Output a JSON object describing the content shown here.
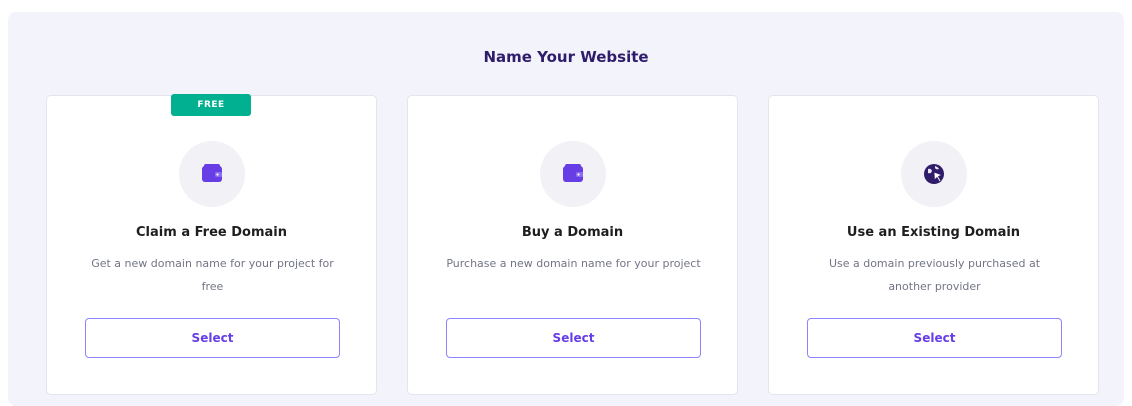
{
  "page": {
    "title": "Name Your Website"
  },
  "colors": {
    "accent": "#673de6",
    "badge": "#00b090",
    "panel_bg": "#f3f3fb"
  },
  "options": [
    {
      "badge": "FREE",
      "icon": "wallet-icon",
      "title": "Claim a Free Domain",
      "description": "Get a new domain name for your project for free",
      "button_label": "Select"
    },
    {
      "icon": "wallet-icon",
      "title": "Buy a Domain",
      "description": "Purchase a new domain name for your project",
      "button_label": "Select"
    },
    {
      "icon": "globe-cursor-icon",
      "title": "Use an Existing Domain",
      "description": "Use a domain previously purchased at another provider",
      "button_label": "Select"
    }
  ]
}
